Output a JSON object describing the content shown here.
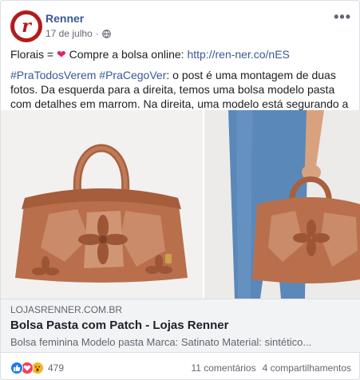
{
  "post": {
    "page_name": "Renner",
    "date": "17 de julho",
    "separator": "·",
    "privacy_icon": "globe-icon",
    "more_icon": "more-options-icon",
    "avatar_letter": "r",
    "line1_text": "Florais = ",
    "line1_heart": "❤",
    "line1_cta": " Compre a bolsa online: ",
    "line1_link": "http://ren-ner.co/nES",
    "hashtag1": "#PraTodosVerem",
    "hashtag2": "#PraCegoVer",
    "description": ": o post é uma montagem de duas fotos. Da esquerda para a direita, temos uma bolsa modelo pasta com detalhes em marrom. Na direita, uma modelo está segurando a mesma bolsa."
  },
  "preview": {
    "domain": "LOJASRENNER.COM.BR",
    "title": "Bolsa Pasta com Patch - Lojas Renner",
    "description": "Bolsa feminina Modelo pasta Marca: Satinato Material: sintético..."
  },
  "footer": {
    "reactions": [
      "like-icon",
      "love-icon",
      "wow-icon"
    ],
    "reaction_count": "479",
    "comments": "11 comentários",
    "shares": "4 compartilhamentos"
  },
  "colors": {
    "link": "#385898",
    "brand_red": "#b31b1b",
    "bag_brown": "#b5704f"
  }
}
